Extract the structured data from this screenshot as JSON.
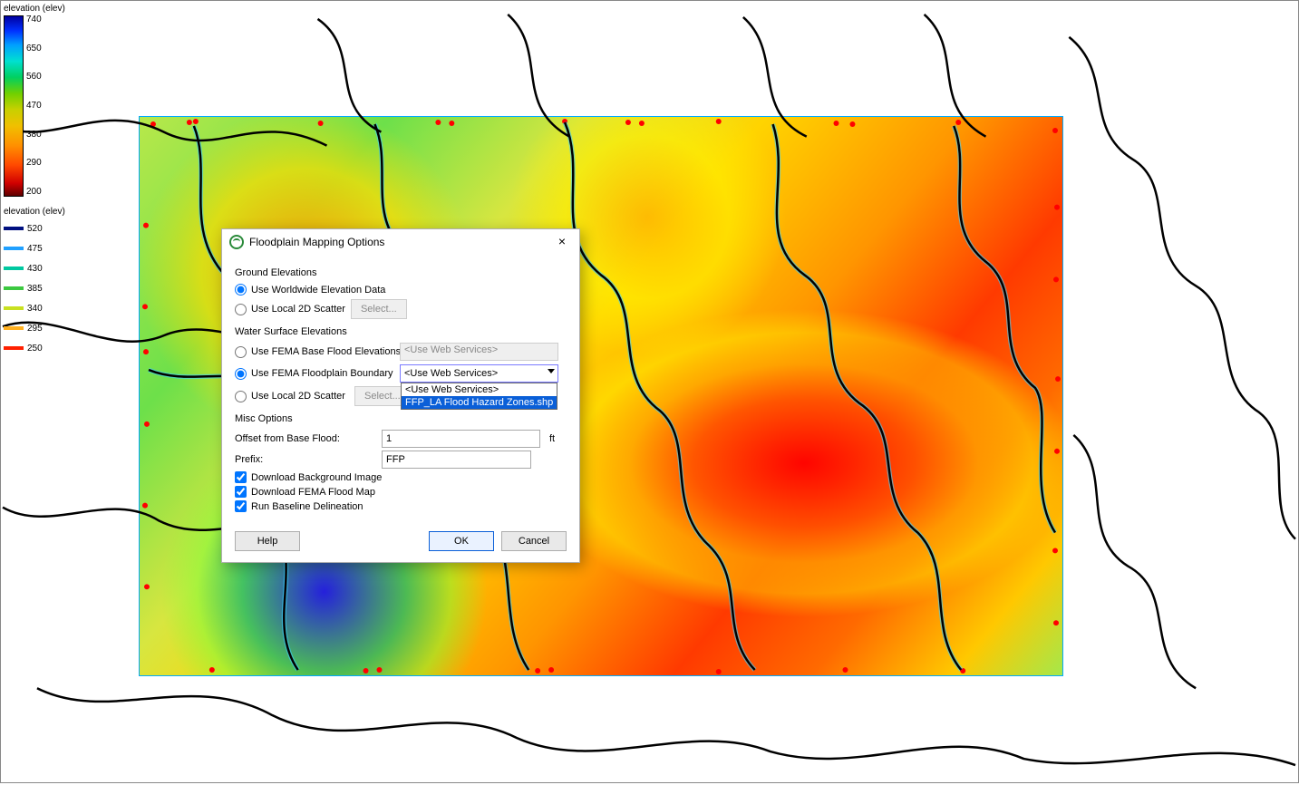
{
  "legend1": {
    "title": "elevation (elev)",
    "ticks": [
      "740",
      "650",
      "560",
      "470",
      "380",
      "290",
      "200"
    ]
  },
  "legend2": {
    "title": "elevation (elev)",
    "rows": [
      {
        "color": "#001080",
        "label": "520"
      },
      {
        "color": "#20a0ff",
        "label": "475"
      },
      {
        "color": "#00c8a0",
        "label": "430"
      },
      {
        "color": "#3cc840",
        "label": "385"
      },
      {
        "color": "#c8e020",
        "label": "340"
      },
      {
        "color": "#ffb020",
        "label": "295"
      },
      {
        "color": "#ff2000",
        "label": "250"
      }
    ]
  },
  "dialog": {
    "title": "Floodplain Mapping Options",
    "section_ground": "Ground Elevations",
    "radio_worldwide": "Use Worldwide Elevation Data",
    "radio_local_ground": "Use Local 2D Scatter",
    "select_btn": "Select...",
    "section_wse": "Water Surface Elevations",
    "radio_fema_bfe": "Use FEMA Base Flood Elevations",
    "bfe_select_value": "<Use Web Services>",
    "radio_fema_boundary": "Use FEMA Floodplain Boundary",
    "boundary_select_value": "<Use Web Services>",
    "boundary_options": [
      "<Use Web Services>",
      "FFP_LA Flood Hazard Zones.shp"
    ],
    "radio_local_wse": "Use Local 2D Scatter",
    "section_misc": "Misc Options",
    "offset_label": "Offset from Base Flood:",
    "offset_value": "1",
    "offset_unit": "ft",
    "prefix_label": "Prefix:",
    "prefix_value": "FFP",
    "cb_bg": "Download Background Image",
    "cb_fema": "Download FEMA Flood Map",
    "cb_baseline": "Run Baseline Delineation",
    "btn_help": "Help",
    "btn_ok": "OK",
    "btn_cancel": "Cancel"
  }
}
